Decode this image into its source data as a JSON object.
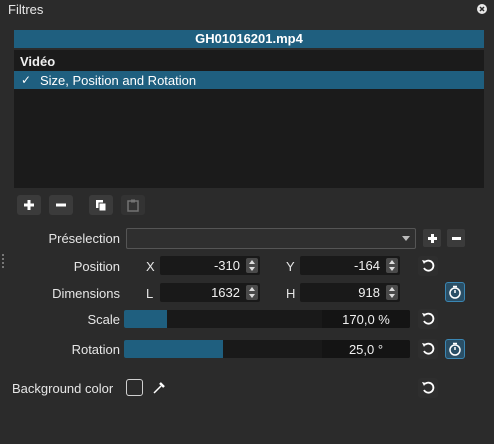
{
  "window": {
    "title": "Filtres"
  },
  "file": {
    "name": "GH01016201.mp4"
  },
  "filters": {
    "category": "Vidéo",
    "items": [
      {
        "label": "Size, Position and Rotation",
        "checked": true
      }
    ]
  },
  "toolbar": {
    "add_icon": "plus-icon",
    "remove_icon": "minus-icon",
    "copy_icon": "copy-icon",
    "paste_icon": "paste-icon"
  },
  "preset": {
    "label": "Préselection",
    "value": ""
  },
  "position": {
    "label": "Position",
    "x_label": "X",
    "x": "-310",
    "y_label": "Y",
    "y": "-164"
  },
  "dimensions": {
    "label": "Dimensions",
    "w_label": "L",
    "w": "1632",
    "h_label": "H",
    "h": "918"
  },
  "scale": {
    "label": "Scale",
    "value": "170,0 %",
    "fill_fraction": 0.15
  },
  "rotation": {
    "label": "Rotation",
    "value": "25,0 °",
    "fill_fraction": 0.345
  },
  "background": {
    "label": "Background color",
    "color": "#2b2b2b"
  },
  "colors": {
    "accent": "#1f5f7f",
    "panel_bg": "#1b1b1b",
    "window_bg": "#2b2b2b"
  }
}
